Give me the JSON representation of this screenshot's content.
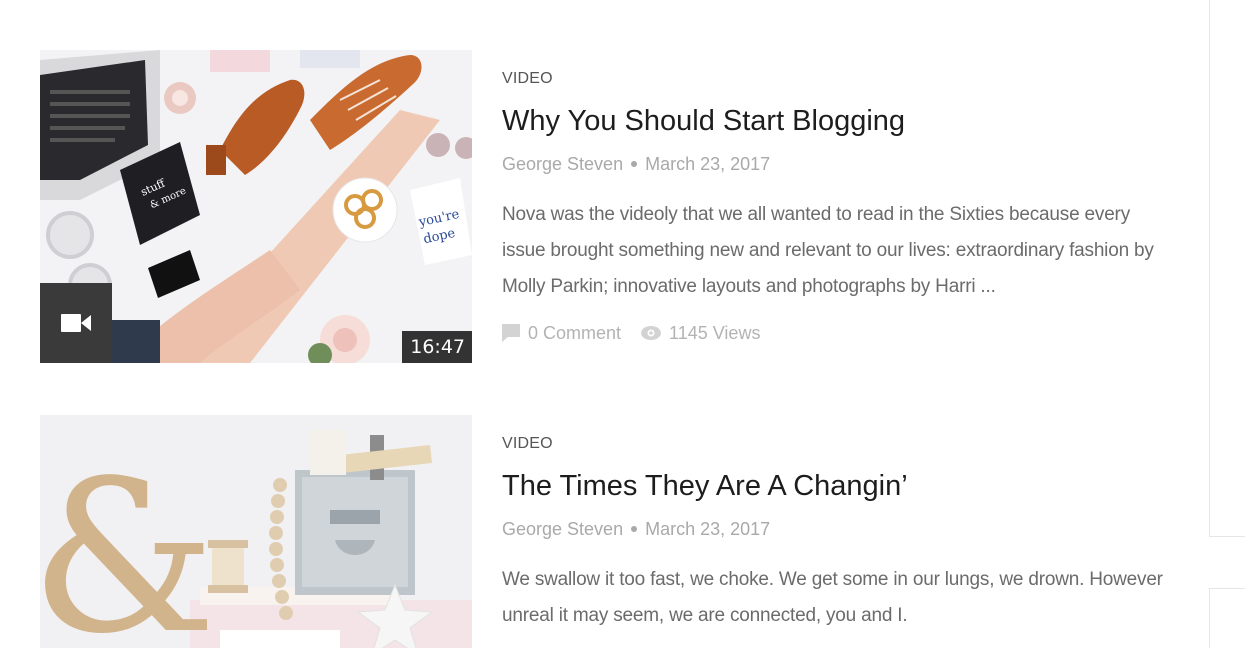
{
  "top_cut_text": "... ... ... ...",
  "posts": [
    {
      "category": "VIDEO",
      "title": "Why You Should Start Blogging",
      "author": "George Steven",
      "date": "March 23, 2017",
      "excerpt": "Nova was the videoly that we all wanted to read in the Sixties because every issue brought something new and relevant to our lives: extraordinary fashion by Molly Parkin; innovative layouts and photographs by Harri ...",
      "comments": "0 Comment",
      "views": "1145 Views",
      "duration": "16:47",
      "thumb_icon": "video-camera-icon"
    },
    {
      "category": "VIDEO",
      "title": "The Times They Are A Changin’",
      "author": "George Steven",
      "date": "March 23, 2017",
      "excerpt": "We swallow it too fast, we choke. We get some in our lungs, we drown. However unreal it may seem, we are connected, you and I."
    }
  ],
  "colors": {
    "title": "#1d1d1d",
    "meta": "#a9a9a9",
    "excerpt": "#6b6b6b",
    "badge": "#3a3a3a"
  }
}
